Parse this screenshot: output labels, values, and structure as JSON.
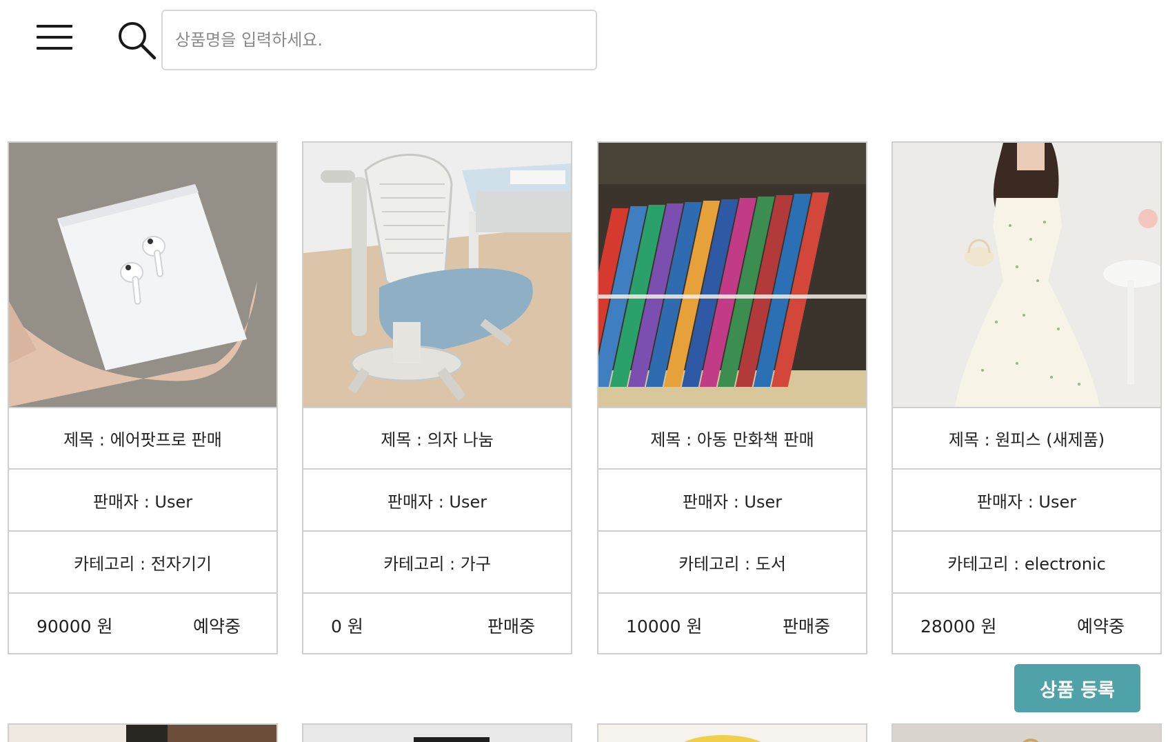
{
  "header": {
    "menu_icon": "hamburger-menu-icon",
    "search_icon": "search-icon",
    "search_placeholder": "상품명을 입력하세요."
  },
  "products": [
    {
      "title": "제목 : 에어팟프로 판매",
      "seller": "판매자 : User",
      "category": "카테고리 : 전자기기",
      "price": "90000 원",
      "status": "예약중"
    },
    {
      "title": "제목 : 의자 나눔",
      "seller": "판매자 : User",
      "category": "카테고리 : 가구",
      "price": "0 원",
      "status": "판매중"
    },
    {
      "title": "제목 : 아동 만화책 판매",
      "seller": "판매자 : User",
      "category": "카테고리 : 도서",
      "price": "10000 원",
      "status": "판매중"
    },
    {
      "title": "제목 : 원피스 (새제품)",
      "seller": "판매자 : User",
      "category": "카테고리 : electronic",
      "price": "28000 원",
      "status": "예약중"
    }
  ],
  "register_button": "상품 등록",
  "colors": {
    "accent": "#4fa3a8",
    "border": "#cfcfcf"
  }
}
